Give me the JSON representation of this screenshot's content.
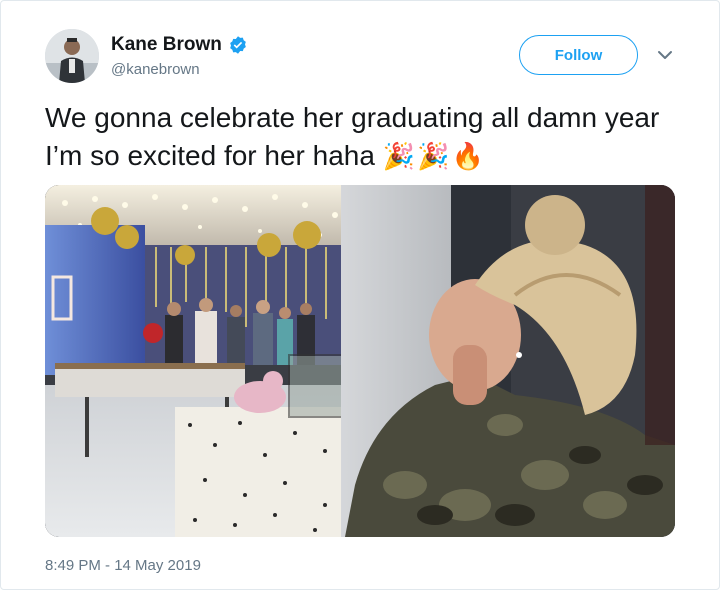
{
  "tweet": {
    "author": {
      "display_name": "Kane Brown",
      "handle": "@kanebrown",
      "verified": true
    },
    "follow_label": "Follow",
    "text": "We gonna celebrate her graduating all damn year I’m so excited for her haha",
    "emojis": "🎉🎉🔥",
    "timestamp": "8:49 PM - 14 May 2019"
  },
  "colors": {
    "accent": "#1da1f2",
    "secondary_text": "#657786",
    "primary_text": "#14171a",
    "border": "#e1e8ed"
  },
  "icons": [
    "verified-badge-icon",
    "chevron-down-icon"
  ]
}
